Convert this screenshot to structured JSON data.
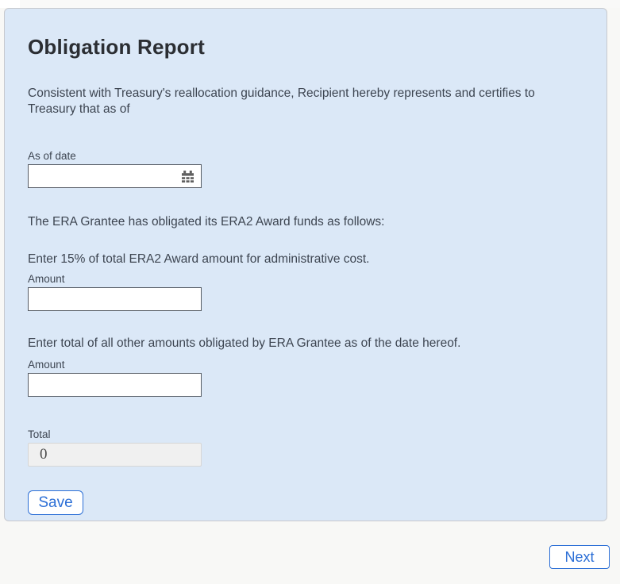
{
  "page": {
    "title": "Obligation Report",
    "intro": "Consistent with Treasury's reallocation guidance, Recipient hereby represents and certifies to Treasury that as of",
    "statement": "The ERA Grantee has obligated its ERA2 Award funds as follows:",
    "instruction_admin": "Enter 15% of total ERA2 Award amount for administrative cost.",
    "instruction_other": "Enter total of all other amounts obligated by ERA Grantee as of the date hereof.",
    "fields": {
      "as_of_date": {
        "label": "As of date",
        "value": "",
        "icon": "calendar-icon"
      },
      "admin_amount": {
        "label": "Amount",
        "value": ""
      },
      "other_amount": {
        "label": "Amount",
        "value": ""
      },
      "total": {
        "label": "Total",
        "value": "0"
      }
    },
    "buttons": {
      "save": "Save",
      "next": "Next"
    }
  },
  "colors": {
    "page_bg": "#f8f8f6",
    "panel_bg": "#dbe8f7",
    "panel_border": "#c7c9ce",
    "title_color": "#2b2e33",
    "text_color": "#3d4551",
    "input_border": "#565c65",
    "accent_blue": "#2c6fd6",
    "disabled_bg": "#f0f0f0",
    "disabled_border": "#d6d6d6",
    "icon_grey": "#606060"
  }
}
